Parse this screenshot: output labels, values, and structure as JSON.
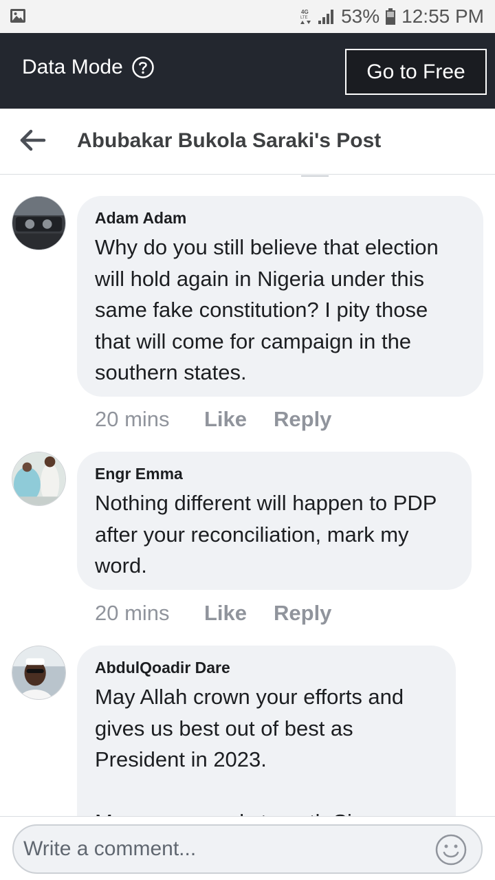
{
  "status_bar": {
    "network": "4G LTE",
    "battery": "53%",
    "time": "12:55 PM",
    "icons": [
      "image-icon",
      "network-icon",
      "signal-icon",
      "battery-icon"
    ]
  },
  "data_bar": {
    "title": "Data Mode",
    "button_label": "Go to Free",
    "icons": [
      "help-icon"
    ],
    "colors": {
      "background": "#23272f",
      "button_background": "#1a1c21",
      "text": "#ffffff"
    }
  },
  "header": {
    "title": "Abubakar Bukola Saraki's Post",
    "icons": [
      "back-arrow-icon"
    ]
  },
  "comments": [
    {
      "author": "Adam Adam",
      "text": "Why do you still believe that election will hold again in Nigeria under this same fake constitution? I pity those that will come for campaign in the southern states.",
      "time": "20 mins",
      "like": "Like",
      "reply": "Reply"
    },
    {
      "author": "Engr Emma",
      "text": "Nothing different will happen to PDP after your reconciliation, mark my word.",
      "time": "20 mins",
      "like": "Like",
      "reply": "Reply"
    },
    {
      "author": "AbdulQoadir Dare",
      "text": "May Allah crown your efforts and gives us best out of best as President in 2023.\n\nMore grace and strength Sir",
      "time": "",
      "like": "",
      "reply": ""
    }
  ],
  "composer": {
    "placeholder": "Write a comment...",
    "value": "",
    "icons": [
      "emoji-icon"
    ]
  },
  "colors": {
    "bubble": "#f0f2f5",
    "meta_text": "#90949c",
    "header_text": "#3e4042"
  }
}
